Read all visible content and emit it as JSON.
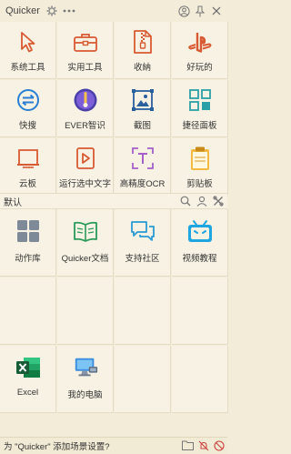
{
  "window": {
    "title": "Quicker"
  },
  "section": {
    "label": "默认"
  },
  "grid1": [
    {
      "label": "系统工具",
      "icon": "cursor-arrow-icon"
    },
    {
      "label": "实用工具",
      "icon": "toolbox-icon"
    },
    {
      "label": "收納",
      "icon": "zip-file-icon"
    },
    {
      "label": "好玩的",
      "icon": "playstation-icon"
    },
    {
      "label": "快搜",
      "icon": "quick-search-icon"
    },
    {
      "label": "EVER智识",
      "icon": "ever-icon"
    },
    {
      "label": "截图",
      "icon": "screenshot-icon"
    },
    {
      "label": "捷径面板",
      "icon": "panel-icon"
    },
    {
      "label": "云板",
      "icon": "cloud-board-icon"
    },
    {
      "label": "运行选中文字",
      "icon": "play-file-icon"
    },
    {
      "label": "高精度OCR",
      "icon": "ocr-icon"
    },
    {
      "label": "剪贴板",
      "icon": "clipboard-icon"
    }
  ],
  "grid2": [
    {
      "label": "动作库",
      "icon": "action-library-icon"
    },
    {
      "label": "Quicker文档",
      "icon": "book-icon"
    },
    {
      "label": "支持社区",
      "icon": "chat-icon"
    },
    {
      "label": "视频教程",
      "icon": "bilibili-icon"
    },
    {
      "label": "",
      "icon": ""
    },
    {
      "label": "",
      "icon": ""
    },
    {
      "label": "",
      "icon": ""
    },
    {
      "label": "",
      "icon": ""
    },
    {
      "label": "Excel",
      "icon": "excel-icon"
    },
    {
      "label": "我的电脑",
      "icon": "computer-icon"
    },
    {
      "label": "",
      "icon": ""
    },
    {
      "label": "",
      "icon": ""
    }
  ],
  "footer": {
    "text": "为 \"Quicker\" 添加场景设置?"
  },
  "colors": {
    "background": "#f3ecd9",
    "accent_orange": "#d85a32",
    "accent_blue": "#2a7fd4"
  }
}
